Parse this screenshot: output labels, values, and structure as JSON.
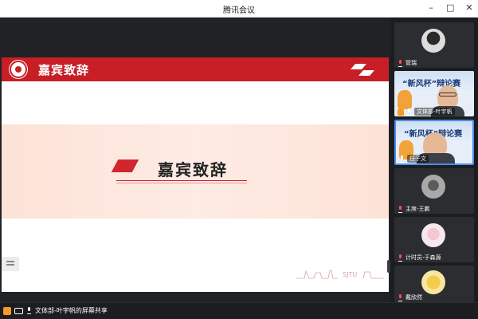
{
  "window": {
    "title": "腾讯会议"
  },
  "slide": {
    "header_title": "嘉宾致辞",
    "center_title": "嘉宾致辞",
    "footer_art_text": "SJTU"
  },
  "participants": [
    {
      "name": "管瑞",
      "type": "avatar",
      "muted": true
    },
    {
      "name": "文体部-叶宇帆",
      "type": "video",
      "poster_text": "“新风杯”辩论赛",
      "muted": false,
      "active": false
    },
    {
      "name": "任子文",
      "type": "video",
      "poster_text": "“新风杯”辩论赛",
      "muted": false,
      "active": true
    },
    {
      "name": "主席-王鹏",
      "type": "avatar",
      "muted": true
    },
    {
      "name": "计时员-于森源",
      "type": "avatar",
      "muted": true
    },
    {
      "name": "戴欣然",
      "type": "avatar",
      "muted": true
    }
  ],
  "bottom_bar": {
    "share_text": "文体部-叶宇帆的屏幕共享"
  },
  "colors": {
    "brand_red": "#c81e25",
    "active_border": "#4c8cf5",
    "band": "#fde2d6"
  }
}
